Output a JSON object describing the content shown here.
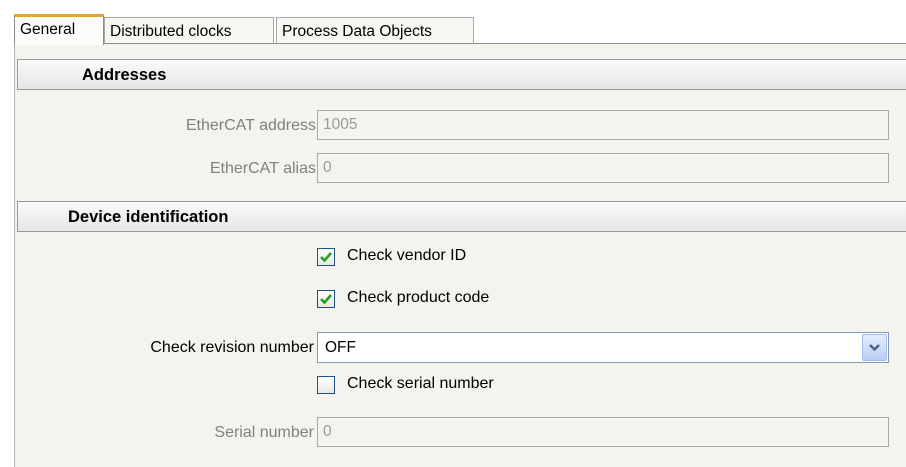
{
  "tabs": [
    "General",
    "Distributed clocks",
    "Process Data Objects"
  ],
  "sections": {
    "addresses": {
      "title": "Addresses",
      "ethercat_address": {
        "label": "EtherCAT address",
        "value": "1005"
      },
      "ethercat_alias": {
        "label": "EtherCAT alias",
        "value": "0"
      }
    },
    "device_identification": {
      "title": "Device identification",
      "check_vendor_id": {
        "label": "Check vendor ID",
        "checked": true
      },
      "check_product_code": {
        "label": "Check product code",
        "checked": true
      },
      "check_revision_number": {
        "label": "Check revision number",
        "value": "OFF"
      },
      "check_serial_number": {
        "label": "Check serial number",
        "checked": false
      },
      "serial_number": {
        "label": "Serial number",
        "value": "0"
      }
    }
  },
  "colors": {
    "active_tab_accent": "#e7a52e",
    "checkmark": "#21a121",
    "panel_background": "#f4f3ee"
  },
  "icons": {
    "dropdown": "chevron-down-icon",
    "check": "checkmark-icon"
  }
}
